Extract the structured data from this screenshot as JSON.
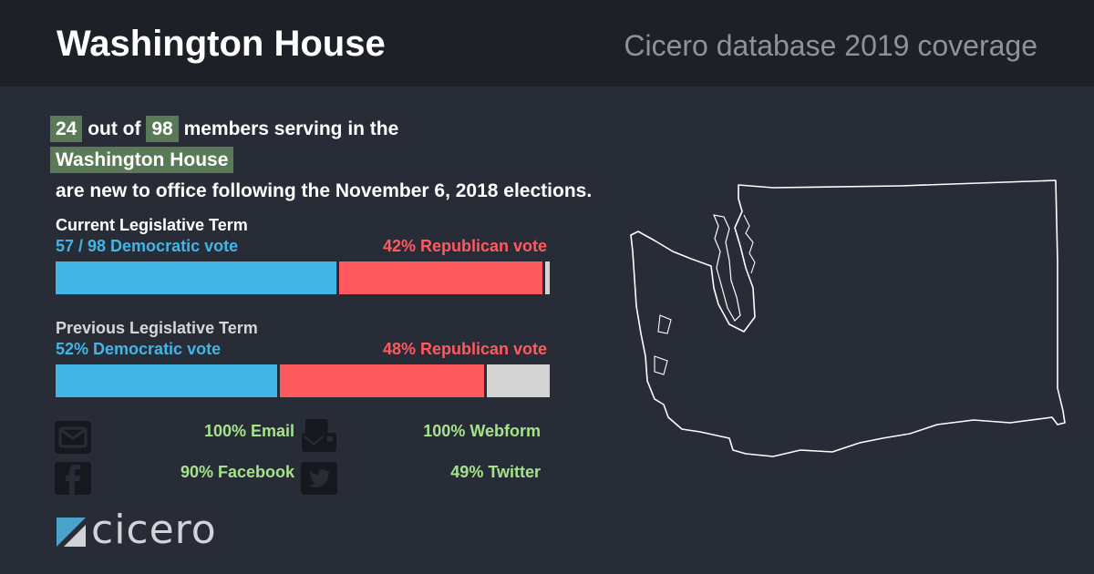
{
  "header": {
    "title": "Washington House",
    "subtitle": "Cicero database 2019 coverage"
  },
  "summary": {
    "new_count": "24",
    "out_of_text": "out of",
    "total_count": "98",
    "members_text": "members serving in the",
    "chamber": "Washington House",
    "tail_text": "are new to office following the November 6, 2018 elections."
  },
  "chart_data": [
    {
      "type": "bar",
      "title": "Current Legislative Term",
      "dem_label": "57 / 98 Democratic vote",
      "rep_label": "42% Republican vote",
      "series": [
        {
          "name": "Democratic",
          "value": 57.5
        },
        {
          "name": "Republican",
          "value": 41.6
        },
        {
          "name": "Other",
          "value": 0.9
        }
      ],
      "colors": {
        "Democratic": "#41b6e6",
        "Republican": "#ff5a5f",
        "Other": "#d4d4d4"
      }
    },
    {
      "type": "bar",
      "title": "Previous Legislative Term",
      "dem_label": "52% Democratic vote",
      "rep_label": "48% Republican vote",
      "series": [
        {
          "name": "Democratic",
          "value": 45.3
        },
        {
          "name": "Republican",
          "value": 41.9
        },
        {
          "name": "Other",
          "value": 12.8
        }
      ],
      "colors": {
        "Democratic": "#41b6e6",
        "Republican": "#ff5a5f",
        "Other": "#d4d4d4"
      }
    }
  ],
  "contact": {
    "email": "100% Email",
    "webform": "100% Webform",
    "facebook": "90% Facebook",
    "twitter": "49% Twitter"
  },
  "logo": {
    "text": "cicero"
  },
  "colors": {
    "background": "#282c37",
    "header": "#1d2027",
    "highlight": "#5a7a57",
    "contact_text": "#a5e38a"
  }
}
